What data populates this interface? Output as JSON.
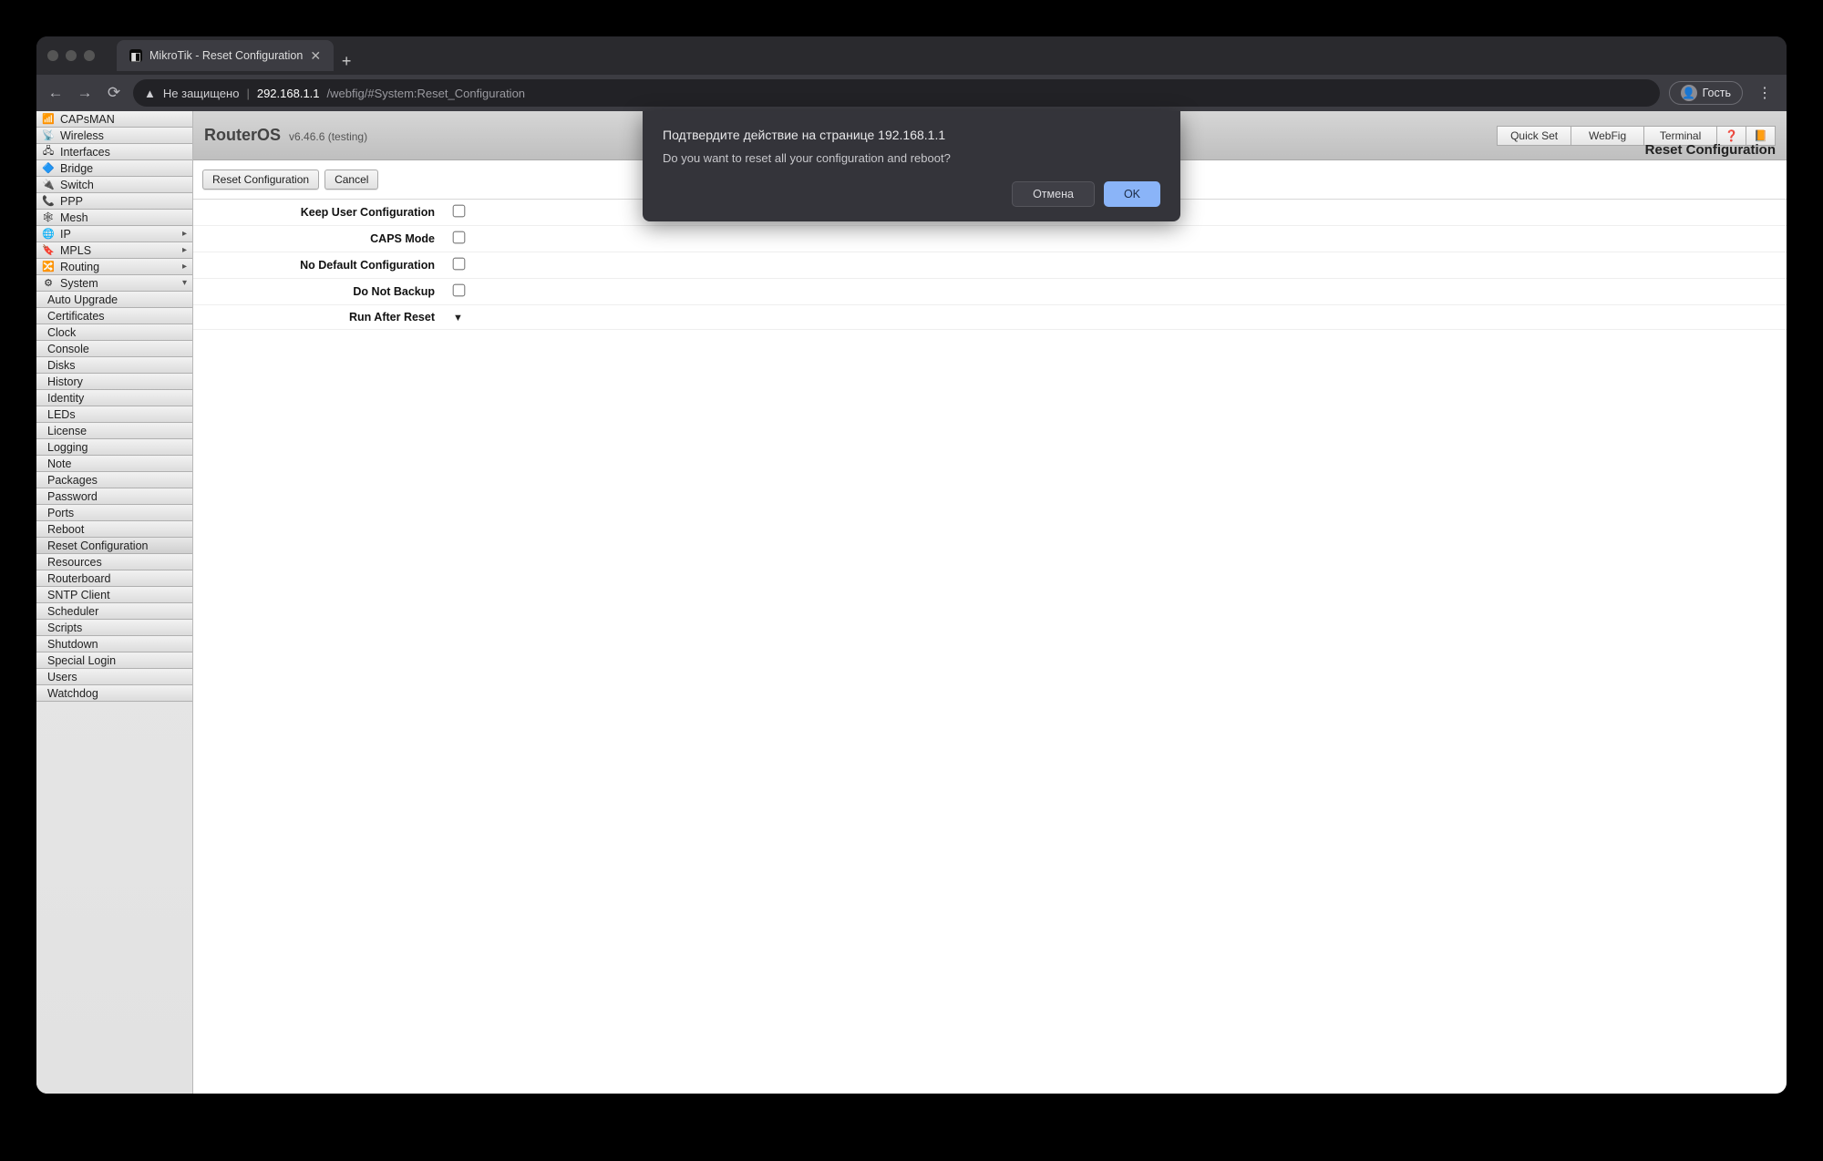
{
  "browser": {
    "tab_title": "MikroTik - Reset Configuration",
    "not_secure": "Не защищено",
    "url_host": "292.168.1.1",
    "url_path": "/webfig/#System:Reset_Configuration",
    "guest_label": "Гость"
  },
  "sidebar": {
    "top": [
      {
        "icon": "📶",
        "label": "CAPsMAN"
      },
      {
        "icon": "📡",
        "label": "Wireless"
      },
      {
        "icon": "🖧",
        "label": "Interfaces"
      },
      {
        "icon": "🔷",
        "label": "Bridge"
      },
      {
        "icon": "🔌",
        "label": "Switch"
      },
      {
        "icon": "📞",
        "label": "PPP"
      },
      {
        "icon": "🕸",
        "label": "Mesh"
      },
      {
        "icon": "🌐",
        "label": "IP",
        "arrow": "▸"
      },
      {
        "icon": "🔖",
        "label": "MPLS",
        "arrow": "▸"
      },
      {
        "icon": "🔀",
        "label": "Routing",
        "arrow": "▸"
      },
      {
        "icon": "⚙",
        "label": "System",
        "arrow": "▾"
      }
    ],
    "system_sub": [
      "Auto Upgrade",
      "Certificates",
      "Clock",
      "Console",
      "Disks",
      "History",
      "Identity",
      "LEDs",
      "License",
      "Logging",
      "Note",
      "Packages",
      "Password",
      "Ports",
      "Reboot",
      "Reset Configuration",
      "Resources",
      "Routerboard",
      "SNTP Client",
      "Scheduler",
      "Scripts",
      "Shutdown",
      "Special Login",
      "Users",
      "Watchdog"
    ],
    "system_active": "Reset Configuration"
  },
  "header": {
    "brand": "RouterOS",
    "version": "v6.46.6 (testing)",
    "tabs": [
      "Quick Set",
      "WebFig",
      "Terminal"
    ],
    "breadcrumb": "Reset Configuration"
  },
  "actions": {
    "reset": "Reset Configuration",
    "cancel": "Cancel"
  },
  "form": {
    "keep_user": "Keep User Configuration",
    "caps_mode": "CAPS Mode",
    "no_default": "No Default Configuration",
    "no_backup": "Do Not Backup",
    "run_after": "Run After Reset"
  },
  "dialog": {
    "title": "Подтвердите действие на странице 192.168.1.1",
    "message": "Do you want to reset all your configuration and reboot?",
    "cancel": "Отмена",
    "ok": "OK"
  }
}
